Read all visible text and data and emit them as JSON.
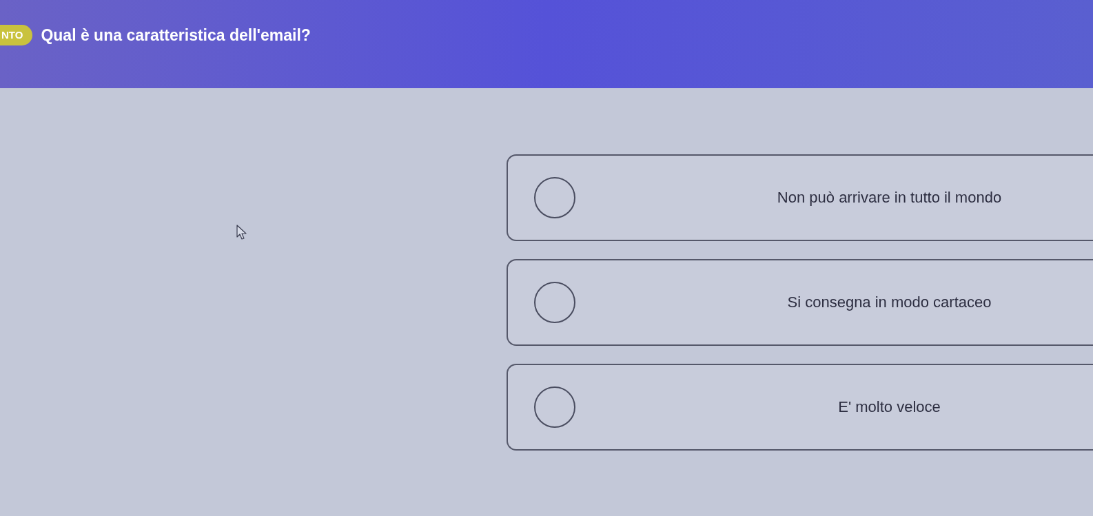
{
  "header": {
    "badge": "NTO",
    "question": "Qual è una caratteristica dell'email?"
  },
  "options": [
    {
      "label": "Non può arrivare in tutto il mondo",
      "selected": false
    },
    {
      "label": "Si consegna in modo cartaceo",
      "selected": false
    },
    {
      "label": "E' molto veloce",
      "selected": false
    }
  ]
}
